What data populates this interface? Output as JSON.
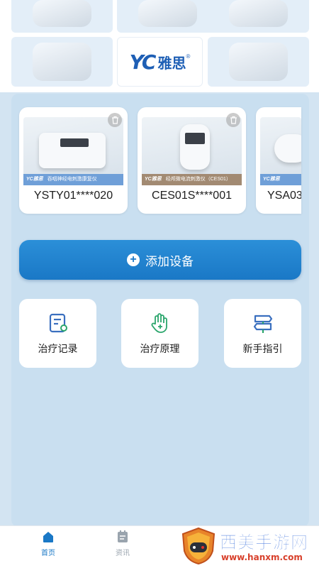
{
  "brand": {
    "logo_mark": "YC",
    "logo_text": "雅思",
    "registered": "®"
  },
  "product_grid": {
    "tiles": [
      {
        "name": "product-tile-1"
      },
      {
        "name": "product-tile-2"
      },
      {
        "name": "product-tile-3"
      },
      {
        "name": "product-tile-4"
      },
      {
        "name": "logo-tile"
      },
      {
        "name": "product-tile-6"
      }
    ]
  },
  "devices": [
    {
      "name": "YSTY01****020",
      "band_brand": "YC雅思",
      "band_text": "吞咽神经电刺激康复仪",
      "band_color": "#6f9fd8"
    },
    {
      "name": "CES01S****001",
      "band_brand": "YC雅思",
      "band_text": "经颅微电流刺激仪（CES01）",
      "band_color": "#a28a72"
    },
    {
      "name": "YSA03",
      "band_brand": "YC雅思",
      "band_text": "",
      "band_color": "#6f9fd8"
    }
  ],
  "add_device": {
    "label": "添加设备"
  },
  "features": [
    {
      "label": "治疗记录",
      "icon": "record-icon"
    },
    {
      "label": "治疗原理",
      "icon": "hand-plus-icon"
    },
    {
      "label": "新手指引",
      "icon": "signpost-icon"
    }
  ],
  "tabs": [
    {
      "label": "首页",
      "icon": "home-icon",
      "active": true
    },
    {
      "label": "资讯",
      "icon": "news-icon",
      "active": false
    }
  ],
  "watermark": {
    "text": "西美手游网",
    "url": "www.hanxm.com"
  },
  "colors": {
    "accent": "#1a78c6",
    "icon_blue": "#3a6fbf",
    "icon_green": "#2aa56b",
    "tab_active": "#1a78c6",
    "tab_inactive": "#9aa4ae"
  }
}
